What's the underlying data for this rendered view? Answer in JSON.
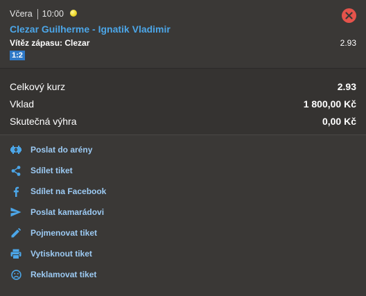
{
  "ticket": {
    "day": "Včera",
    "time": "10:00",
    "sport_icon": "tennis-ball-icon",
    "event": "Clezar Guilherme - Ignatik Vladimir",
    "market_label": "Vítěz zápasu: Clezar",
    "odds": "2.93",
    "score": "1:2"
  },
  "summary": {
    "total_odds_label": "Celkový kurz",
    "total_odds_value": "2.93",
    "stake_label": "Vklad",
    "stake_value": "1 800,00 Kč",
    "win_label": "Skutečná výhra",
    "win_value": "0,00 Kč"
  },
  "actions": [
    {
      "label": "Poslat do arény",
      "icon": "arena-icon"
    },
    {
      "label": "Sdílet tiket",
      "icon": "share-icon"
    },
    {
      "label": "Sdílet na Facebook",
      "icon": "facebook-icon"
    },
    {
      "label": "Poslat kamarádovi",
      "icon": "send-icon"
    },
    {
      "label": "Pojmenovat tiket",
      "icon": "pencil-icon"
    },
    {
      "label": "Vytisknout tiket",
      "icon": "printer-icon"
    },
    {
      "label": "Reklamovat tiket",
      "icon": "sad-face-icon"
    }
  ],
  "colors": {
    "background": "#3a3836",
    "summary_background": "#353331",
    "link": "#4ca6e8",
    "action_text": "#9ccaf3",
    "action_icon": "#4ca6e8",
    "close": "#e5534b",
    "badge": "#2f79c7"
  }
}
